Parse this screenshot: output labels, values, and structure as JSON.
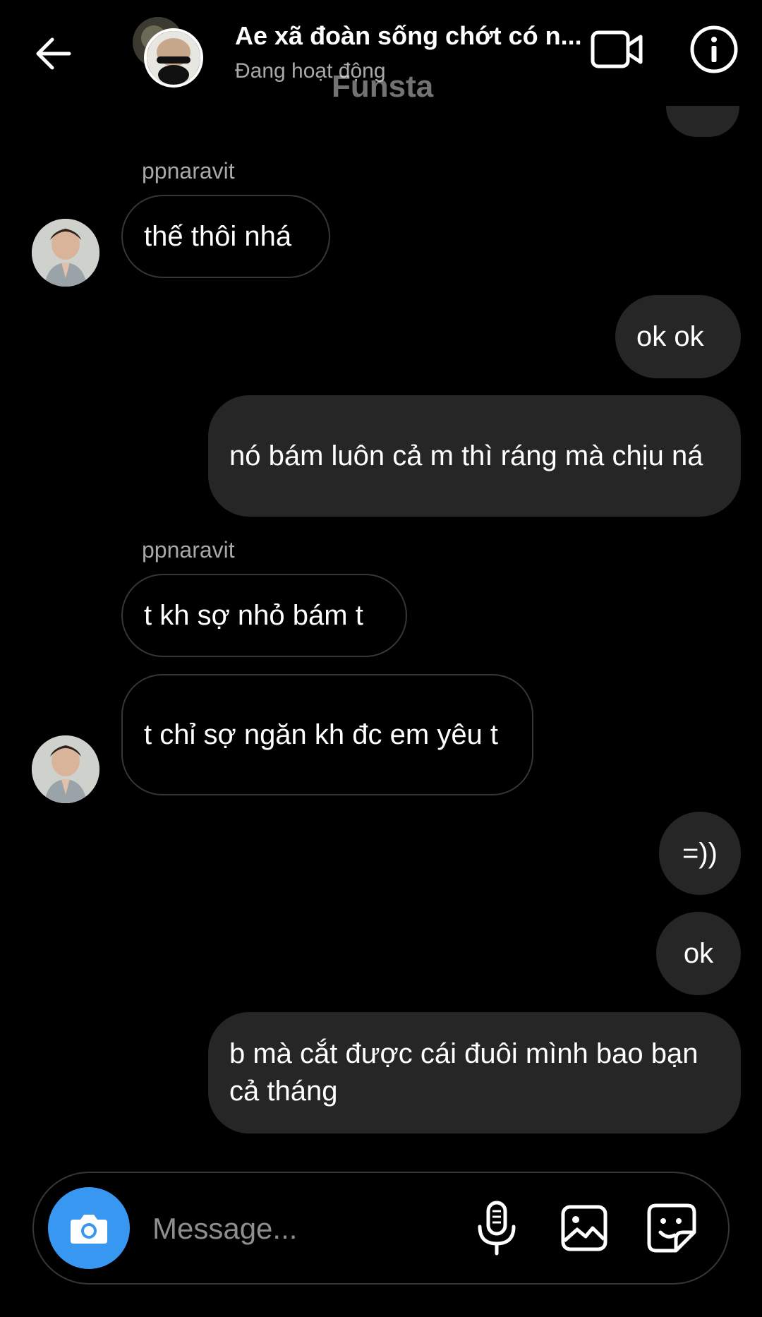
{
  "header": {
    "title": "Ae xã đoàn sống chớt có n...",
    "status": "Đang hoạt động",
    "watermark": "Funsta"
  },
  "messages": [
    {
      "sender": "ppnaravit",
      "direction": "incoming",
      "text": "thế thôi nhá"
    },
    {
      "direction": "outgoing",
      "text": "ok ok"
    },
    {
      "direction": "outgoing",
      "text": "nó bám luôn cả m thì ráng mà chịu ná"
    },
    {
      "sender": "ppnaravit",
      "direction": "incoming",
      "text": "t kh sợ nhỏ bám t"
    },
    {
      "direction": "incoming",
      "text": "t chỉ sợ ngăn kh đc em yêu t"
    },
    {
      "direction": "outgoing",
      "text": "=))"
    },
    {
      "direction": "outgoing",
      "text": "ok"
    },
    {
      "direction": "outgoing",
      "text": "b mà cắt được cái đuôi mình bao bạn cả tháng"
    }
  ],
  "composer": {
    "placeholder": "Message..."
  },
  "icons": {
    "back": "arrow-left-icon",
    "video": "video-call-icon",
    "info": "info-icon",
    "camera": "camera-icon",
    "mic": "microphone-icon",
    "gallery": "gallery-icon",
    "sticker": "sticker-icon"
  },
  "colors": {
    "background": "#000000",
    "outgoing_bubble": "#262626",
    "incoming_border": "#363636",
    "camera_button": "#3897f0",
    "secondary_text": "#a8a8a8"
  }
}
